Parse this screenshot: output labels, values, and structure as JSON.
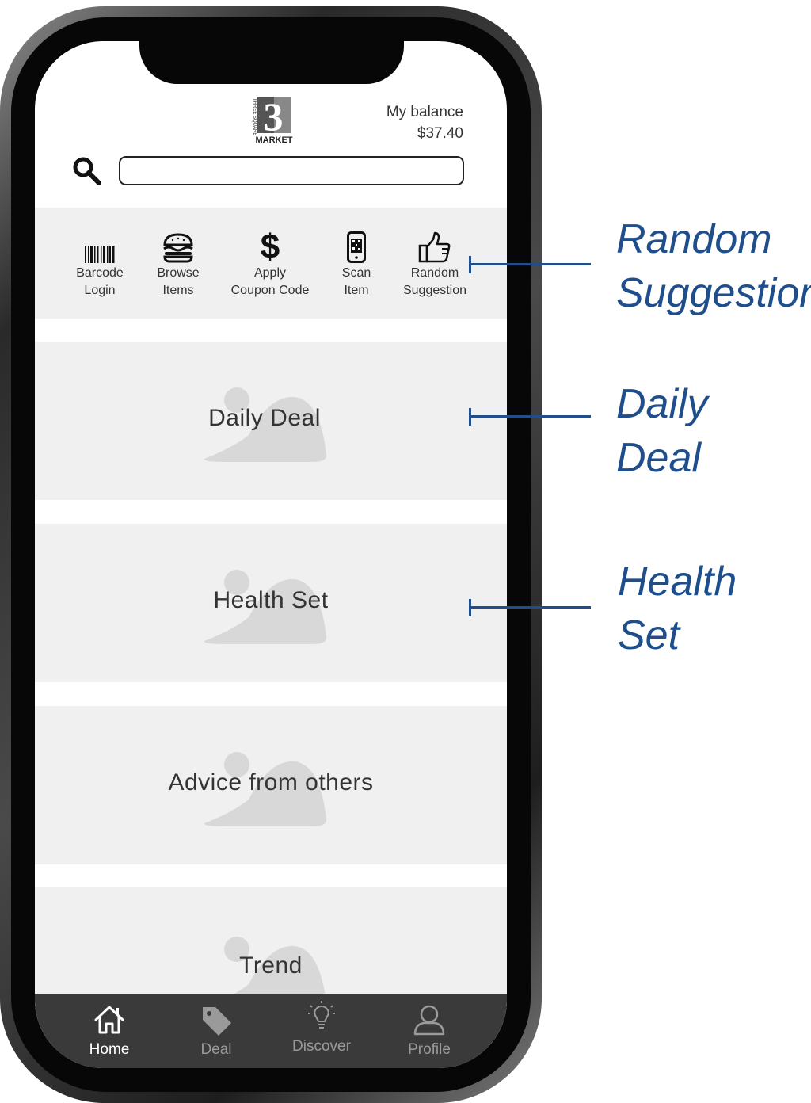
{
  "header": {
    "logo": {
      "letters_top": "THREE SQUARE",
      "number": "3",
      "letters_bottom": "MARKET"
    },
    "balance_label": "My balance",
    "balance_value": "$37.40"
  },
  "search": {
    "value": "",
    "placeholder": ""
  },
  "actions": [
    {
      "icon": "barcode-icon",
      "line1": "Barcode",
      "line2": "Login"
    },
    {
      "icon": "burger-icon",
      "line1": "Browse",
      "line2": "Items"
    },
    {
      "icon": "dollar-icon",
      "line1": "Apply",
      "line2": "Coupon Code"
    },
    {
      "icon": "phone-qr-icon",
      "line1": "Scan",
      "line2": "Item"
    },
    {
      "icon": "thumbs-up-icon",
      "line1": "Random",
      "line2": "Suggestion"
    }
  ],
  "cards": [
    {
      "title": "Daily Deal"
    },
    {
      "title": "Health Set"
    },
    {
      "title": "Advice from others"
    },
    {
      "title": "Trend"
    }
  ],
  "nav": [
    {
      "icon": "home-icon",
      "label": "Home",
      "active": true
    },
    {
      "icon": "tag-icon",
      "label": "Deal",
      "active": false
    },
    {
      "icon": "lightbulb-icon",
      "label": "Discover",
      "active": false
    },
    {
      "icon": "person-icon",
      "label": "Profile",
      "active": false
    }
  ],
  "annotations": [
    {
      "line1": "Random",
      "line2": "Suggestion"
    },
    {
      "line1": "Daily",
      "line2": "Deal"
    },
    {
      "line1": "Health",
      "line2": "Set"
    }
  ],
  "colors": {
    "annotation": "#1f4e8c",
    "panel": "#f0f0f0",
    "nav_bg": "#3a3a3a"
  }
}
